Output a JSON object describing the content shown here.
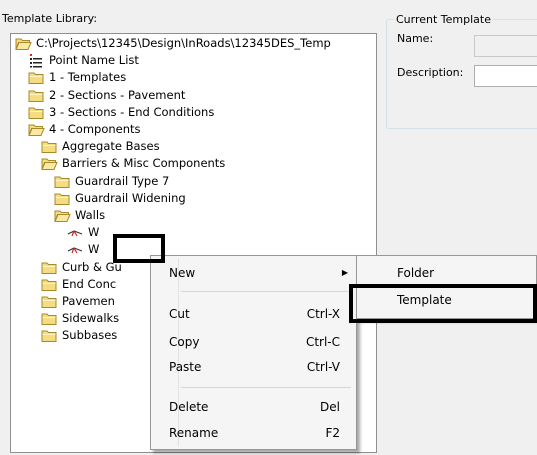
{
  "left_panel": {
    "label": "Template Library:"
  },
  "tree": [
    {
      "label": "C:\\Projects\\12345\\Design\\InRoads\\12345DES_Temp",
      "icon": "folder-open-icon"
    },
    {
      "label": "Point Name List",
      "icon": "point-list-icon"
    },
    {
      "label": "1 - Templates",
      "icon": "folder-icon"
    },
    {
      "label": "2 - Sections - Pavement",
      "icon": "folder-icon"
    },
    {
      "label": "3 - Sections - End Conditions",
      "icon": "folder-icon"
    },
    {
      "label": "4 - Components",
      "icon": "folder-open-icon"
    },
    {
      "label": "Aggregate Bases",
      "icon": "folder-icon"
    },
    {
      "label": "Barriers & Misc Components",
      "icon": "folder-open-icon"
    },
    {
      "label": "Guardrail Type 7",
      "icon": "folder-icon"
    },
    {
      "label": "Guardrail Widening",
      "icon": "folder-icon"
    },
    {
      "label": "Walls",
      "icon": "folder-open-icon"
    },
    {
      "label": "W",
      "icon": "template-icon"
    },
    {
      "label": "W",
      "icon": "template-icon"
    },
    {
      "label": "Curb & Gu",
      "icon": "folder-icon"
    },
    {
      "label": "End Conc",
      "icon": "folder-icon"
    },
    {
      "label": "Pavemen",
      "icon": "folder-icon"
    },
    {
      "label": "Sidewalks",
      "icon": "folder-icon"
    },
    {
      "label": "Subbases",
      "icon": "folder-icon"
    }
  ],
  "current_template": {
    "group_label": "Current Template",
    "name_label": "Name:",
    "name_value": "",
    "description_label": "Description:",
    "description_value": ""
  },
  "context_menu": {
    "items": [
      {
        "label": "New",
        "shortcut": "",
        "submenu_arrow": "▶"
      },
      {
        "label": "Cut",
        "shortcut": "Ctrl-X"
      },
      {
        "label": "Copy",
        "shortcut": "Ctrl-C"
      },
      {
        "label": "Paste",
        "shortcut": "Ctrl-V"
      },
      {
        "label": "Delete",
        "shortcut": "Del"
      },
      {
        "label": "Rename",
        "shortcut": "F2"
      }
    ]
  },
  "submenu": {
    "items": [
      {
        "label": "Folder"
      },
      {
        "label": "Template"
      }
    ]
  },
  "colors": {
    "folder": "#f3dc82",
    "folder_edge": "#a88a2a",
    "menu_bg": "#f5f5f5",
    "highlight_border": "#000000"
  }
}
